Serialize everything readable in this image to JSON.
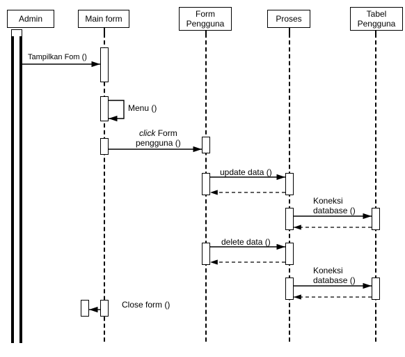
{
  "participants": {
    "admin": "Admin",
    "main_form": "Main form",
    "form_pengguna": "Form Pengguna",
    "proses": "Proses",
    "tabel_pengguna": "Tabel Pengguna"
  },
  "messages": {
    "tampilkan_form": "Tampilkan Fom ()",
    "menu": "Menu ()",
    "click_form_pengguna_line1_italic": "click",
    "click_form_pengguna_line1_rest": " Form",
    "click_form_pengguna_line2": "pengguna ()",
    "update_data": "update data ()",
    "koneksi_db1": "Koneksi database ()",
    "delete_data": "delete data ()",
    "koneksi_db2": "Koneksi database ()",
    "close_form": "Close form ()"
  },
  "chart_data": {
    "type": "sequence-diagram",
    "participants": [
      "Admin",
      "Main form",
      "Form Pengguna",
      "Proses",
      "Tabel Pengguna"
    ],
    "interactions": [
      {
        "from": "Admin",
        "to": "Main form",
        "label": "Tampilkan Fom ()",
        "style": "solid"
      },
      {
        "from": "Main form",
        "to": "Main form",
        "label": "Menu ()",
        "style": "self"
      },
      {
        "from": "Main form",
        "to": "Form Pengguna",
        "label": "click Form pengguna ()",
        "style": "solid"
      },
      {
        "from": "Form Pengguna",
        "to": "Proses",
        "label": "update data ()",
        "style": "solid"
      },
      {
        "from": "Proses",
        "to": "Form Pengguna",
        "label": "",
        "style": "dashed-return"
      },
      {
        "from": "Proses",
        "to": "Tabel Pengguna",
        "label": "Koneksi database ()",
        "style": "solid"
      },
      {
        "from": "Tabel Pengguna",
        "to": "Proses",
        "label": "",
        "style": "dashed-return"
      },
      {
        "from": "Form Pengguna",
        "to": "Proses",
        "label": "delete data ()",
        "style": "solid"
      },
      {
        "from": "Proses",
        "to": "Form Pengguna",
        "label": "",
        "style": "dashed-return"
      },
      {
        "from": "Proses",
        "to": "Tabel Pengguna",
        "label": "Koneksi database ()",
        "style": "solid"
      },
      {
        "from": "Tabel Pengguna",
        "to": "Proses",
        "label": "",
        "style": "dashed-return"
      },
      {
        "from": "Main form",
        "to": "Admin",
        "label": "Close form ()",
        "style": "solid"
      }
    ]
  }
}
